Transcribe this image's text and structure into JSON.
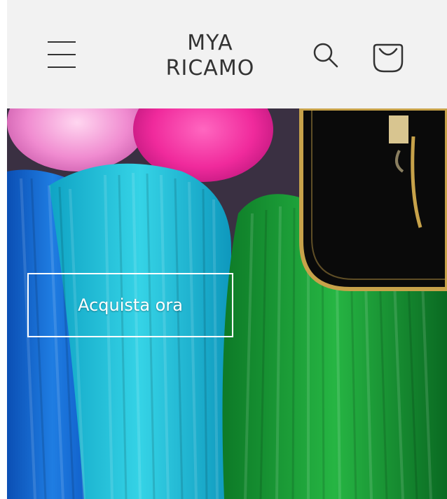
{
  "header": {
    "brand_line1": "MYA",
    "brand_line2": "RICAMO",
    "menu_icon": "hamburger-menu-icon",
    "search_icon": "search-icon",
    "cart_icon": "cart-icon",
    "background": "#f2f2f2"
  },
  "hero": {
    "cta_label": "Acquista ora",
    "threads": [
      "blue",
      "cyan",
      "green",
      "pink",
      "magenta"
    ],
    "colors": {
      "blue": "#1a6fd8",
      "cyan": "#22c1d6",
      "green": "#1fa33a",
      "pink": "#f08bd0",
      "magenta": "#f02a9c",
      "frame": "#c7a24a"
    }
  }
}
